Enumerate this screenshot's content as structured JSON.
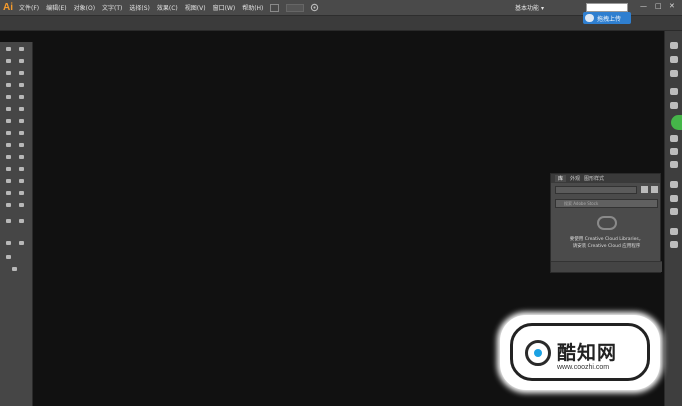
{
  "app": {
    "logo": "Ai"
  },
  "menu": [
    "文件(F)",
    "编辑(E)",
    "对象(O)",
    "文字(T)",
    "选择(S)",
    "效果(C)",
    "视图(V)",
    "窗口(W)",
    "帮助(H)"
  ],
  "workspace": {
    "label": "基本功能",
    "caret": "▾"
  },
  "search": {
    "placeholder": ""
  },
  "window_controls": {
    "minimize": "—",
    "maximize": "□",
    "close": "✕"
  },
  "upload": {
    "label": "拖拽上传"
  },
  "panel": {
    "tabs": [
      "库",
      "外观",
      "图形样式"
    ],
    "search_placeholder": "搜索 Adobe Stock",
    "message_line1": "要使用 Creative Cloud Libraries，",
    "message_line2": "请安装 Creative Cloud 应用程序"
  },
  "watermark": {
    "title": "酷知网",
    "url": "www.coozhi.com"
  },
  "icons": {
    "pen": "pen-icon",
    "type": "type-icon",
    "hand": "hand-icon",
    "zoom": "zoom-icon",
    "layers": "layers-icon",
    "libraries": "cc-libraries-icon"
  }
}
